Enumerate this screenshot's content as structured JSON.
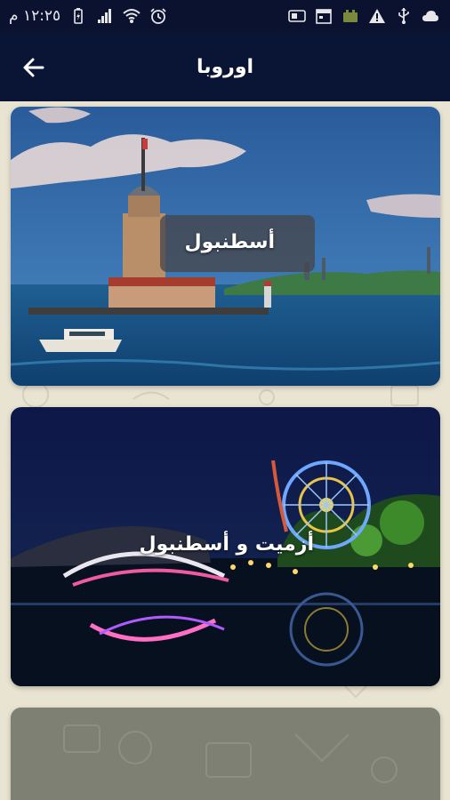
{
  "status_bar": {
    "time": "١٢:٢٥ م",
    "icons": [
      "battery-icon",
      "signal-icon",
      "wifi-icon",
      "alarm-icon",
      "sim-card-icon",
      "calendar-icon",
      "sim-manager-icon",
      "warning-icon",
      "usb-icon",
      "cloud-icon"
    ]
  },
  "app_bar": {
    "title": "اوروبا",
    "back_icon": "arrow-back-icon"
  },
  "destinations": [
    {
      "label": "أسطنبول"
    },
    {
      "label": "أزميت و أسطنبول"
    },
    {
      "label": ""
    }
  ],
  "colors": {
    "status_bar_bg": "#0b1230",
    "app_bar_bg": "#0a1535",
    "page_bg": "#e9e4d2"
  }
}
